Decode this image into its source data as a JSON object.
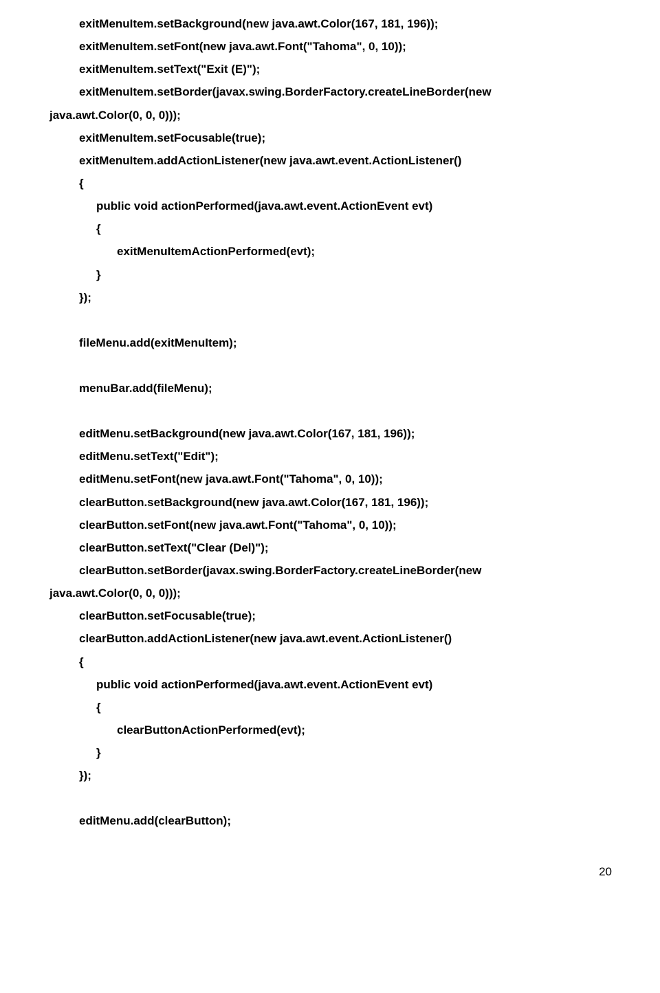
{
  "lines": {
    "l01": "exitMenuItem.setBackground(new java.awt.Color(167, 181, 196));",
    "l02": "exitMenuItem.setFont(new java.awt.Font(\"Tahoma\", 0, 10));",
    "l03": "exitMenuItem.setText(\"Exit     (E)\");",
    "l04": "exitMenuItem.setBorder(javax.swing.BorderFactory.createLineBorder(new",
    "l05": "java.awt.Color(0, 0, 0)));",
    "l06": "exitMenuItem.setFocusable(true);",
    "l07": "exitMenuItem.addActionListener(new java.awt.event.ActionListener()",
    "l08": "{",
    "l09": "public void actionPerformed(java.awt.event.ActionEvent evt)",
    "l10": "{",
    "l11": "exitMenuItemActionPerformed(evt);",
    "l12": "}",
    "l13": "});",
    "l14": "fileMenu.add(exitMenuItem);",
    "l15": "menuBar.add(fileMenu);",
    "l16": "editMenu.setBackground(new java.awt.Color(167, 181, 196));",
    "l17": "editMenu.setText(\"Edit\");",
    "l18": "editMenu.setFont(new java.awt.Font(\"Tahoma\", 0, 10));",
    "l19": "clearButton.setBackground(new java.awt.Color(167, 181, 196));",
    "l20": "clearButton.setFont(new java.awt.Font(\"Tahoma\", 0, 10));",
    "l21": "clearButton.setText(\"Clear   (Del)\");",
    "l22": "clearButton.setBorder(javax.swing.BorderFactory.createLineBorder(new",
    "l23": "java.awt.Color(0, 0, 0)));",
    "l24": "clearButton.setFocusable(true);",
    "l25": "clearButton.addActionListener(new java.awt.event.ActionListener()",
    "l26": "{",
    "l27": "public void actionPerformed(java.awt.event.ActionEvent evt)",
    "l28": "{",
    "l29": "clearButtonActionPerformed(evt);",
    "l30": "}",
    "l31": "});",
    "l32": "editMenu.add(clearButton);"
  },
  "pagenum": "20"
}
